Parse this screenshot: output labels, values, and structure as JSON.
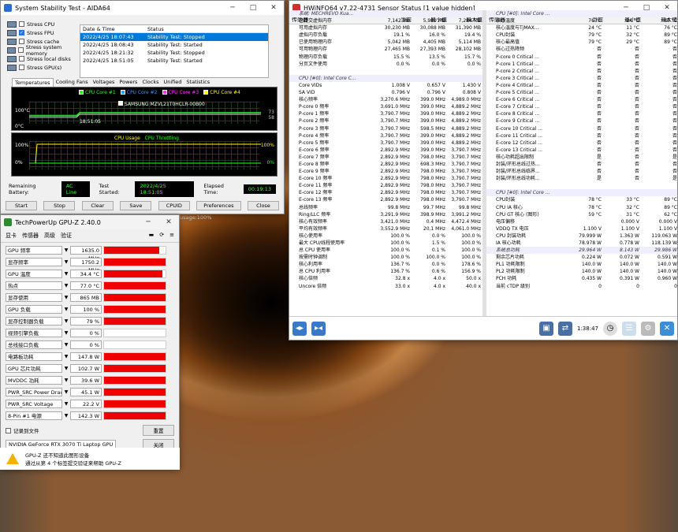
{
  "aida": {
    "title": "System Stability Test - AIDA64",
    "stress": [
      "Stress CPU",
      "Stress FPU",
      "Stress cache",
      "Stress system memory",
      "Stress local disks",
      "Stress GPU(s)"
    ],
    "stress_checked": [
      false,
      true,
      false,
      false,
      false,
      false
    ],
    "log_headers": [
      "Date & Time",
      "Status"
    ],
    "log": [
      [
        "2022/4/25 18:07:43",
        "Stability Test: Stopped"
      ],
      [
        "2022/4/25 18:08:43",
        "Stability Test: Started"
      ],
      [
        "2022/4/25 18:21:32",
        "Stability Test: Stopped"
      ],
      [
        "2022/4/25 18:51:05",
        "Stability Test: Started"
      ]
    ],
    "tabs": [
      "Temperatures",
      "Cooling Fans",
      "Voltages",
      "Powers",
      "Clocks",
      "Unified",
      "Statistics"
    ],
    "legend": [
      "CPU Core #1",
      "CPU Core #2",
      "CPU Core #3",
      "CPU Core #4"
    ],
    "legend_disk": "SAMSUNG MZVL21T0HCLR-00B00",
    "y_top": "100°C",
    "y_bot": "0°C",
    "time_label": "18:51:05",
    "right_top": "73",
    "right_bot": "58",
    "usage_legend": "CPU Usage",
    "throttle_legend": "CPU Throttling",
    "u_top": "100%",
    "u_bot": "0%",
    "u_rtop": "100%",
    "u_rbot": "0%",
    "battery_label": "Remaining Battery:",
    "battery": "AC Line",
    "started_label": "Test Started:",
    "started": "2022/4/25 18:51:05",
    "elapsed_label": "Elapsed Time:",
    "elapsed": "00:19:13",
    "buttons": [
      "Start",
      "Stop",
      "Clear",
      "Save",
      "CPUID",
      "Preferences",
      "Close"
    ]
  },
  "hw": {
    "title": "HWiNFO64 v7.22-4731 Sensor Status [1 value hidden]",
    "headers": [
      "传感器",
      "当前",
      "最小值",
      "最大值"
    ],
    "left": [
      [
        "系统: MECHREVO Kua...",
        "",
        "",
        ""
      ],
      [
        "已提交虚拟内存",
        "7,142 MB",
        "5,981 MB",
        "7,284 MB"
      ],
      [
        "可用虚拟内存",
        "30,230 MB",
        "30,088 MB",
        "31,390 MB"
      ],
      [
        "虚拟内存负载",
        "19.1 %",
        "16.0 %",
        "19.4 %"
      ],
      [
        "已使用物理内存",
        "5,042 MB",
        "4,405 MB",
        "5,114 MB"
      ],
      [
        "可用物理内存",
        "27,465 MB",
        "27,393 MB",
        "28,102 MB"
      ],
      [
        "物理内存负载",
        "15.5 %",
        "13.5 %",
        "15.7 %"
      ],
      [
        "分页文件使用",
        "0.0 %",
        "0.0 %",
        "0.0 %"
      ],
      [
        "",
        "",
        "",
        ""
      ],
      [
        "CPU [#0]: Intel Core C...",
        "",
        "",
        ""
      ],
      [
        "Core VIDs",
        "1.008 V",
        "0.657 V",
        "1.430 V"
      ],
      [
        "SA VID",
        "0.796 V",
        "0.796 V",
        "0.808 V"
      ],
      [
        "核心频率",
        "3,270.6 MHz",
        "399.0 MHz",
        "4,989.0 MHz"
      ],
      [
        "P-core 0 频率",
        "3,691.0 MHz",
        "399.0 MHz",
        "4,889.2 MHz"
      ],
      [
        "P-core 1 频率",
        "3,790.7 MHz",
        "399.0 MHz",
        "4,889.2 MHz"
      ],
      [
        "P-core 2 频率",
        "3,790.7 MHz",
        "399.0 MHz",
        "4,889.2 MHz"
      ],
      [
        "P-core 3 频率",
        "3,790.7 MHz",
        "598.5 MHz",
        "4,889.2 MHz"
      ],
      [
        "P-core 4 频率",
        "3,790.7 MHz",
        "399.0 MHz",
        "4,889.2 MHz"
      ],
      [
        "P-core 5 频率",
        "3,790.7 MHz",
        "399.0 MHz",
        "4,889.2 MHz"
      ],
      [
        "E-core 6 频率",
        "2,892.9 MHz",
        "399.0 MHz",
        "3,790.7 MHz"
      ],
      [
        "E-core 7 频率",
        "2,892.9 MHz",
        "798.0 MHz",
        "3,790.7 MHz"
      ],
      [
        "E-core 8 频率",
        "2,892.9 MHz",
        "698.3 MHz",
        "3,790.7 MHz"
      ],
      [
        "E-core 9 频率",
        "2,892.9 MHz",
        "798.0 MHz",
        "3,790.7 MHz"
      ],
      [
        "E-core 10 频率",
        "2,892.9 MHz",
        "798.0 MHz",
        "3,790.7 MHz"
      ],
      [
        "E-core 11 频率",
        "2,892.9 MHz",
        "798.0 MHz",
        "3,790.7 MHz"
      ],
      [
        "E-core 12 频率",
        "2,892.9 MHz",
        "798.0 MHz",
        "3,790.7 MHz"
      ],
      [
        "E-core 13 频率",
        "2,892.9 MHz",
        "798.0 MHz",
        "3,790.7 MHz"
      ],
      [
        "总线频率",
        "99.8 MHz",
        "99.7 MHz",
        "99.8 MHz"
      ],
      [
        "Ring/LLC 频率",
        "3,291.9 MHz",
        "398.9 MHz",
        "3,991.2 MHz"
      ],
      [
        "核心有效频率",
        "3,421.0 MHz",
        "0.4 MHz",
        "4,472.4 MHz"
      ],
      [
        "平均有效频率",
        "3,552.9 MHz",
        "20.1 MHz",
        "4,061.0 MHz"
      ],
      [
        "核心使用率",
        "100.0 %",
        "0.0 %",
        "100.0 %"
      ],
      [
        "最大 CPU/线程使用率",
        "100.0 %",
        "1.5 %",
        "100.0 %"
      ],
      [
        "总 CPU 使用率",
        "100.0 %",
        "0.1 %",
        "100.0 %"
      ],
      [
        "按需时钟调制",
        "100.0 %",
        "100.0 %",
        "100.0 %"
      ],
      [
        "核心利用率",
        "136.7 %",
        "0.0 %",
        "178.6 %"
      ],
      [
        "总 CPU 利用率",
        "136.7 %",
        "0.6 %",
        "156.9 %"
      ],
      [
        "核心倍频",
        "32.8 x",
        "4.0 x",
        "50.0 x"
      ],
      [
        "Uncore 倍频",
        "33.0 x",
        "4.0 x",
        "40.0 x"
      ]
    ],
    "right": [
      [
        "CPU [#0]: Intel Core ...",
        "",
        "",
        ""
      ],
      [
        "核心温度",
        "76 °C",
        "24 °C",
        "89 °C"
      ],
      [
        "核心温度与TjMAX...",
        "24 °C",
        "11 °C",
        "76 °C"
      ],
      [
        "CPU封装",
        "79 °C",
        "32 °C",
        "89 °C"
      ],
      [
        "核心最高值",
        "79 °C",
        "29 °C",
        "89 °C"
      ],
      [
        "核心过热降频",
        "否",
        "否",
        "否"
      ],
      [
        "P-core 0 Critical ...",
        "否",
        "否",
        "否"
      ],
      [
        "P-core 1 Critical ...",
        "否",
        "否",
        "否"
      ],
      [
        "P-core 2 Critical ...",
        "否",
        "否",
        "否"
      ],
      [
        "P-core 3 Critical ...",
        "否",
        "否",
        "否"
      ],
      [
        "P-core 4 Critical ...",
        "否",
        "否",
        "否"
      ],
      [
        "P-core 5 Critical ...",
        "否",
        "否",
        "否"
      ],
      [
        "E-core 6 Critical ...",
        "否",
        "否",
        "否"
      ],
      [
        "E-core 7 Critical ...",
        "否",
        "否",
        "否"
      ],
      [
        "E-core 8 Critical ...",
        "否",
        "否",
        "否"
      ],
      [
        "E-core 9 Critical ...",
        "否",
        "否",
        "否"
      ],
      [
        "E-core 10 Critical ...",
        "否",
        "否",
        "否"
      ],
      [
        "E-core 11 Critical ...",
        "否",
        "否",
        "否"
      ],
      [
        "E-core 12 Critical ...",
        "否",
        "否",
        "否"
      ],
      [
        "E-core 13 Critical ...",
        "否",
        "否",
        "否"
      ],
      [
        "核心功耗超出限制",
        "是",
        "否",
        "是"
      ],
      [
        "封装/环形总线过热...",
        "否",
        "否",
        "否"
      ],
      [
        "封装/环形总线临界...",
        "否",
        "否",
        "否"
      ],
      [
        "封装/环形总线功耗...",
        "是",
        "否",
        "是"
      ],
      [
        "",
        "",
        "",
        ""
      ],
      [
        "CPU [#0]: Intel Core ...",
        "",
        "",
        ""
      ],
      [
        "CPU封装",
        "78 °C",
        "33 °C",
        "89 °C"
      ],
      [
        "CPU IA 核心",
        "78 °C",
        "32 °C",
        "89 °C"
      ],
      [
        "CPU GT 核心 (图形)",
        "59 °C",
        "31 °C",
        "62 °C"
      ],
      [
        "电压偏移",
        "",
        "0.000 V",
        "0.000 V"
      ],
      [
        "VDDQ TX 电压",
        "1.100 V",
        "1.100 V",
        "1.100 V"
      ],
      [
        "CPU 封装功耗",
        "79.999 W",
        "1.363 W",
        "119.063 W"
      ],
      [
        "IA 核心功耗",
        "78.978 W",
        "0.778 W",
        "118.139 W"
      ],
      [
        "系统总功耗",
        "29.964 W",
        "8.143 W",
        "29.986 W"
      ],
      [
        "剩余芯片功耗",
        "0.224 W",
        "0.072 W",
        "0.591 W"
      ],
      [
        "PL1 功耗限制",
        "140.0 W",
        "140.0 W",
        "140.0 W"
      ],
      [
        "PL2 功耗限制",
        "140.0 W",
        "140.0 W",
        "140.0 W"
      ],
      [
        "PCH 功耗",
        "0.435 W",
        "0.391 W",
        "0.960 W"
      ],
      [
        "当前 cTDP 级别",
        "0",
        "0",
        "0"
      ]
    ],
    "clock": "1:38:47"
  },
  "gpuz": {
    "title": "TechPowerUp GPU-Z 2.40.0",
    "menu": [
      "显卡",
      "传感器",
      "高级",
      "验证"
    ],
    "rows": [
      [
        "GPU 频率",
        "1635.0 MHz",
        0.9
      ],
      [
        "显存频率",
        "1750.2 MHz",
        1.0
      ],
      [
        "GPU 温度",
        "34.4 °C",
        0.95
      ],
      [
        "热点",
        "77.0 °C",
        1.0
      ],
      [
        "显存使用",
        "865 MB",
        1.0
      ],
      [
        "GPU 负载",
        "100 %",
        1.0
      ],
      [
        "显存控制器负载",
        "79 %",
        1.0
      ],
      [
        "视频引擎负载",
        "0 %",
        0
      ],
      [
        "总线接口负载",
        "0 %",
        0
      ],
      [
        "电路板功耗",
        "147.8 W",
        1.0
      ],
      [
        "GPU 芯片功耗",
        "102.7 W",
        1.0
      ],
      [
        "MVDDC 功耗",
        "39.6 W",
        1.0
      ],
      [
        "PWR_SRC Power Draw",
        "45.1 W",
        1.0
      ],
      [
        "PWR_SRC Voltage",
        "22.2 V",
        1.0
      ],
      [
        "8-Pin #1 电源",
        "142.3 W",
        1.0
      ]
    ],
    "log_label": "记录到文件",
    "reset": "重置",
    "gpu_name": "NVIDIA GeForce RTX 3070 Ti Laptop GPU",
    "close": "关闭",
    "warn1": "GPU-Z 还不知道此图形设备",
    "warn2": "通过从第 4 个标签提交验证来帮助 GPU-Z"
  },
  "desktop": {
    "usage_text": "usage:100%",
    "cmd_text": "%%%%%%%%%%%%%%%%%%%%%%%%%%%%%%%%"
  }
}
